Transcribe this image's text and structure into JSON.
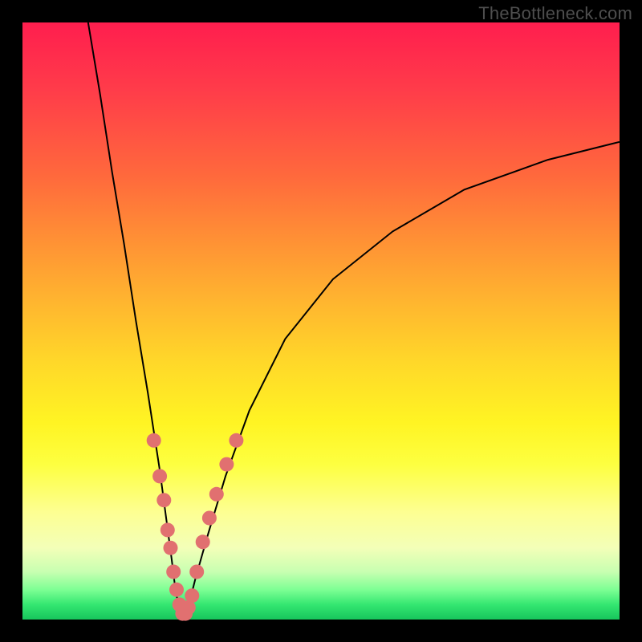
{
  "watermark": "TheBottleneck.com",
  "colors": {
    "frame": "#000000",
    "curve": "#000000",
    "dot": "#e17070",
    "gradient_top": "#ff1e4e",
    "gradient_bottom": "#17c55c"
  },
  "chart_data": {
    "type": "line",
    "title": "",
    "xlabel": "",
    "ylabel": "",
    "xlim": [
      0,
      100
    ],
    "ylim": [
      0,
      100
    ],
    "grid": false,
    "legend": false,
    "note": "Axes are unlabeled in the image. x is approximately left→right 0–100; y is approximately bottom→top 0–100. Curve values are visually estimated.",
    "series": [
      {
        "name": "curve-left",
        "x": [
          11,
          13,
          15,
          17,
          19,
          21,
          23,
          25,
          25.5,
          26,
          26.5,
          27
        ],
        "y": [
          100,
          88,
          75,
          63,
          50,
          38,
          25,
          10,
          6,
          3,
          1,
          0
        ]
      },
      {
        "name": "curve-right",
        "x": [
          27,
          28,
          29,
          31,
          34,
          38,
          44,
          52,
          62,
          74,
          88,
          100
        ],
        "y": [
          0,
          3,
          7,
          14,
          24,
          35,
          47,
          57,
          65,
          72,
          77,
          80
        ]
      }
    ],
    "scatter": {
      "name": "highlighted-points",
      "note": "Pink dots along the lower portion of the V-curve; positions visually estimated.",
      "points": [
        {
          "x": 22.0,
          "y": 30
        },
        {
          "x": 23.0,
          "y": 24
        },
        {
          "x": 23.7,
          "y": 20
        },
        {
          "x": 24.3,
          "y": 15
        },
        {
          "x": 24.8,
          "y": 12
        },
        {
          "x": 25.3,
          "y": 8
        },
        {
          "x": 25.8,
          "y": 5
        },
        {
          "x": 26.3,
          "y": 2.5
        },
        {
          "x": 26.8,
          "y": 1
        },
        {
          "x": 27.3,
          "y": 1
        },
        {
          "x": 27.8,
          "y": 2
        },
        {
          "x": 28.4,
          "y": 4
        },
        {
          "x": 29.2,
          "y": 8
        },
        {
          "x": 30.2,
          "y": 13
        },
        {
          "x": 31.3,
          "y": 17
        },
        {
          "x": 32.5,
          "y": 21
        },
        {
          "x": 34.2,
          "y": 26
        },
        {
          "x": 35.8,
          "y": 30
        }
      ]
    }
  }
}
